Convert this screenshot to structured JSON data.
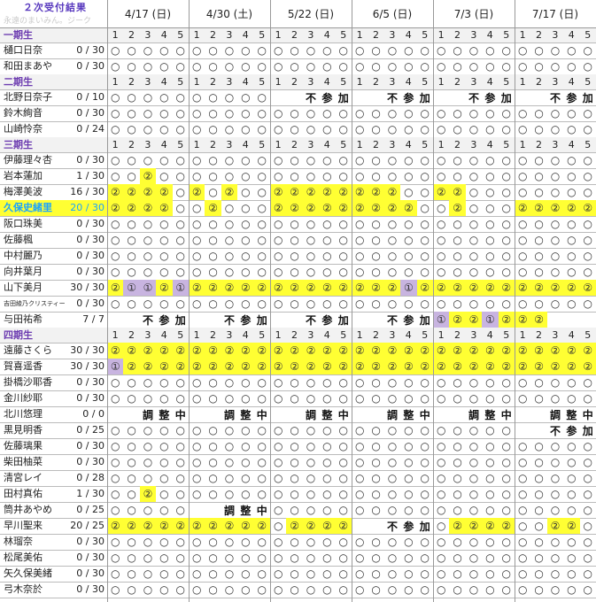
{
  "header": {
    "title": "２次受付結果",
    "watermark": "永遠のまいみん。ジーク"
  },
  "dates": [
    "4/17 (日)",
    "4/30 (土)",
    "5/22 (日)",
    "6/5 (日)",
    "7/3 (日)",
    "7/17 (日)"
  ],
  "slot_numbers": [
    "1",
    "2",
    "3",
    "4",
    "5"
  ],
  "rows": [
    {
      "type": "section",
      "label": "一期生"
    },
    {
      "type": "member",
      "name": "樋口日奈",
      "count": "0 / 30",
      "cells": [
        "o",
        "o",
        "o",
        "o",
        "o",
        "o",
        "o",
        "o",
        "o",
        "o",
        "o",
        "o",
        "o",
        "o",
        "o",
        "o",
        "o",
        "o",
        "o",
        "o",
        "o",
        "o",
        "o",
        "o",
        "o",
        "o",
        "o",
        "o",
        "o",
        "o"
      ]
    },
    {
      "type": "member",
      "name": "和田まあや",
      "count": "0 / 30",
      "cells": [
        "o",
        "o",
        "o",
        "o",
        "o",
        "o",
        "o",
        "o",
        "o",
        "o",
        "o",
        "o",
        "o",
        "o",
        "o",
        "o",
        "o",
        "o",
        "o",
        "o",
        "o",
        "o",
        "o",
        "o",
        "o",
        "o",
        "o",
        "o",
        "o",
        "o"
      ]
    },
    {
      "type": "section",
      "label": "二期生"
    },
    {
      "type": "member",
      "name": "北野日奈子",
      "count": "0 / 10",
      "cells": [
        "o",
        "o",
        "o",
        "o",
        "o",
        "o",
        "o",
        "o",
        "o",
        "o",
        "",
        "",
        "不",
        "参",
        "加",
        "",
        "",
        "不",
        "参",
        "加",
        "",
        "",
        "不",
        "参",
        "加",
        "",
        "",
        "不",
        "参",
        "加"
      ]
    },
    {
      "type": "member",
      "name": "鈴木絢音",
      "count": "0 / 30",
      "cells": [
        "o",
        "o",
        "o",
        "o",
        "o",
        "o",
        "o",
        "o",
        "o",
        "o",
        "o",
        "o",
        "o",
        "o",
        "o",
        "o",
        "o",
        "o",
        "o",
        "o",
        "o",
        "o",
        "o",
        "o",
        "o",
        "o",
        "o",
        "o",
        "o",
        "o"
      ]
    },
    {
      "type": "member",
      "name": "山崎怜奈",
      "count": "0 / 24",
      "cells": [
        "o",
        "o",
        "o",
        "o",
        "o",
        "o",
        "o",
        "o",
        "o",
        "o",
        "o",
        "o",
        "o",
        "o",
        "o",
        "o",
        "o",
        "o",
        "o",
        "o",
        "o",
        "o",
        "o",
        "o",
        "o",
        "o",
        "o",
        "o",
        "o",
        "o"
      ]
    },
    {
      "type": "section",
      "label": "三期生"
    },
    {
      "type": "member",
      "name": "伊藤理々杏",
      "count": "0 / 30",
      "cells": [
        "o",
        "o",
        "o",
        "o",
        "o",
        "o",
        "o",
        "o",
        "o",
        "o",
        "o",
        "o",
        "o",
        "o",
        "o",
        "o",
        "o",
        "o",
        "o",
        "o",
        "o",
        "o",
        "o",
        "o",
        "o",
        "o",
        "o",
        "o",
        "o",
        "o"
      ]
    },
    {
      "type": "member",
      "name": "岩本蓮加",
      "count": "1 / 30",
      "cells": [
        "o",
        "o",
        "Y2",
        "o",
        "o",
        "o",
        "o",
        "o",
        "o",
        "o",
        "o",
        "o",
        "o",
        "o",
        "o",
        "o",
        "o",
        "o",
        "o",
        "o",
        "o",
        "o",
        "o",
        "o",
        "o",
        "o",
        "o",
        "o",
        "o",
        "o"
      ]
    },
    {
      "type": "member",
      "name": "梅澤美波",
      "count": "16 / 30",
      "cells": [
        "Y2",
        "Y2",
        "Y2",
        "Y2",
        "o",
        "Y2",
        "o",
        "Y2",
        "o",
        "o",
        "Y2",
        "Y2",
        "Y2",
        "Y2",
        "Y2",
        "Y2",
        "Y2",
        "Y2",
        "o",
        "o",
        "Y2",
        "Y2",
        "o",
        "o",
        "o",
        "o",
        "o",
        "o",
        "o",
        "o"
      ]
    },
    {
      "type": "member",
      "name": "久保史緒里",
      "count": "20 / 30",
      "hl": true,
      "cells": [
        "Y2",
        "Y2",
        "Y2",
        "Y2",
        "o",
        "o",
        "Y2",
        "o",
        "o",
        "o",
        "Y2",
        "Y2",
        "Y2",
        "Y2",
        "Y2",
        "Y2",
        "Y2",
        "Y2",
        "Y2",
        "o",
        "o",
        "Y2",
        "o",
        "o",
        "o",
        "Y2",
        "Y2",
        "Y2",
        "Y2",
        "Y2"
      ]
    },
    {
      "type": "member",
      "name": "阪口珠美",
      "count": "0 / 30",
      "cells": [
        "o",
        "o",
        "o",
        "o",
        "o",
        "o",
        "o",
        "o",
        "o",
        "o",
        "o",
        "o",
        "o",
        "o",
        "o",
        "o",
        "o",
        "o",
        "o",
        "o",
        "o",
        "o",
        "o",
        "o",
        "o",
        "o",
        "o",
        "o",
        "o",
        "o"
      ]
    },
    {
      "type": "member",
      "name": "佐藤楓",
      "count": "0 / 30",
      "cells": [
        "o",
        "o",
        "o",
        "o",
        "o",
        "o",
        "o",
        "o",
        "o",
        "o",
        "o",
        "o",
        "o",
        "o",
        "o",
        "o",
        "o",
        "o",
        "o",
        "o",
        "o",
        "o",
        "o",
        "o",
        "o",
        "o",
        "o",
        "o",
        "o",
        "o"
      ]
    },
    {
      "type": "member",
      "name": "中村麗乃",
      "count": "0 / 30",
      "cells": [
        "o",
        "o",
        "o",
        "o",
        "o",
        "o",
        "o",
        "o",
        "o",
        "o",
        "o",
        "o",
        "o",
        "o",
        "o",
        "o",
        "o",
        "o",
        "o",
        "o",
        "o",
        "o",
        "o",
        "o",
        "o",
        "o",
        "o",
        "o",
        "o",
        "o"
      ]
    },
    {
      "type": "member",
      "name": "向井葉月",
      "count": "0 / 30",
      "cells": [
        "o",
        "o",
        "o",
        "o",
        "o",
        "o",
        "o",
        "o",
        "o",
        "o",
        "o",
        "o",
        "o",
        "o",
        "o",
        "o",
        "o",
        "o",
        "o",
        "o",
        "o",
        "o",
        "o",
        "o",
        "o",
        "o",
        "o",
        "o",
        "o",
        "o"
      ]
    },
    {
      "type": "member",
      "name": "山下美月",
      "count": "30 / 30",
      "cells": [
        "Y2",
        "P1",
        "P1",
        "Y2",
        "P1",
        "Y2",
        "Y2",
        "Y2",
        "Y2",
        "Y2",
        "Y2",
        "Y2",
        "Y2",
        "Y2",
        "Y2",
        "Y2",
        "Y2",
        "Y2",
        "P1",
        "Y2",
        "Y2",
        "Y2",
        "Y2",
        "Y2",
        "Y2",
        "Y2",
        "Y2",
        "Y2",
        "Y2",
        "Y2"
      ]
    },
    {
      "type": "member",
      "name": "吉田綾乃クリスティー",
      "small": true,
      "count": "0 / 30",
      "cells": [
        "o",
        "o",
        "o",
        "o",
        "o",
        "o",
        "o",
        "o",
        "o",
        "o",
        "o",
        "o",
        "o",
        "o",
        "o",
        "o",
        "o",
        "o",
        "o",
        "o",
        "o",
        "o",
        "o",
        "o",
        "o",
        "o",
        "o",
        "o",
        "o",
        "o"
      ]
    },
    {
      "type": "member",
      "name": "与田祐希",
      "count": "7 / 7",
      "cells": [
        "",
        "",
        "不",
        "参",
        "加",
        "",
        "",
        "不",
        "参",
        "加",
        "",
        "",
        "不",
        "参",
        "加",
        "",
        "",
        "不",
        "参",
        "加",
        "P1",
        "Y2",
        "Y2",
        "P1",
        "Y2",
        "Y2",
        "Y2",
        "",
        "",
        ""
      ]
    },
    {
      "type": "section",
      "label": "四期生"
    },
    {
      "type": "member",
      "name": "遠藤さくら",
      "count": "30 / 30",
      "cells": [
        "Y2",
        "Y2",
        "Y2",
        "Y2",
        "Y2",
        "Y2",
        "Y2",
        "Y2",
        "Y2",
        "Y2",
        "Y2",
        "Y2",
        "Y2",
        "Y2",
        "Y2",
        "Y2",
        "Y2",
        "Y2",
        "Y2",
        "Y2",
        "Y2",
        "Y2",
        "Y2",
        "Y2",
        "Y2",
        "Y2",
        "Y2",
        "Y2",
        "Y2",
        "Y2"
      ]
    },
    {
      "type": "member",
      "name": "賀喜遥香",
      "count": "30 / 30",
      "cells": [
        "P1",
        "Y2",
        "Y2",
        "Y2",
        "Y2",
        "Y2",
        "Y2",
        "Y2",
        "Y2",
        "Y2",
        "Y2",
        "Y2",
        "Y2",
        "Y2",
        "Y2",
        "Y2",
        "Y2",
        "Y2",
        "Y2",
        "Y2",
        "Y2",
        "Y2",
        "Y2",
        "Y2",
        "Y2",
        "Y2",
        "Y2",
        "Y2",
        "Y2",
        "Y2"
      ]
    },
    {
      "type": "member",
      "name": "掛橋沙耶香",
      "count": "0 / 30",
      "cells": [
        "o",
        "o",
        "o",
        "o",
        "o",
        "o",
        "o",
        "o",
        "o",
        "o",
        "o",
        "o",
        "o",
        "o",
        "o",
        "o",
        "o",
        "o",
        "o",
        "o",
        "o",
        "o",
        "o",
        "o",
        "o",
        "o",
        "o",
        "o",
        "o",
        "o"
      ]
    },
    {
      "type": "member",
      "name": "金川紗耶",
      "count": "0 / 30",
      "cells": [
        "o",
        "o",
        "o",
        "o",
        "o",
        "o",
        "o",
        "o",
        "o",
        "o",
        "o",
        "o",
        "o",
        "o",
        "o",
        "o",
        "o",
        "o",
        "o",
        "o",
        "o",
        "o",
        "o",
        "o",
        "o",
        "o",
        "o",
        "o",
        "o",
        "o"
      ]
    },
    {
      "type": "member",
      "name": "北川悠理",
      "count": "0 / 0",
      "cells": [
        "",
        "",
        "調",
        "整",
        "中",
        "",
        "",
        "調",
        "整",
        "中",
        "",
        "",
        "調",
        "整",
        "中",
        "",
        "",
        "調",
        "整",
        "中",
        "",
        "",
        "調",
        "整",
        "中",
        "",
        "",
        "調",
        "整",
        "中"
      ]
    },
    {
      "type": "member",
      "name": "黒見明香",
      "count": "0 / 25",
      "cells": [
        "o",
        "o",
        "o",
        "o",
        "o",
        "o",
        "o",
        "o",
        "o",
        "o",
        "o",
        "o",
        "o",
        "o",
        "o",
        "o",
        "o",
        "o",
        "o",
        "o",
        "o",
        "o",
        "o",
        "o",
        "o",
        "",
        "",
        "不",
        "参",
        "加"
      ]
    },
    {
      "type": "member",
      "name": "佐藤璃果",
      "count": "0 / 30",
      "cells": [
        "o",
        "o",
        "o",
        "o",
        "o",
        "o",
        "o",
        "o",
        "o",
        "o",
        "o",
        "o",
        "o",
        "o",
        "o",
        "o",
        "o",
        "o",
        "o",
        "o",
        "o",
        "o",
        "o",
        "o",
        "o",
        "o",
        "o",
        "o",
        "o",
        "o"
      ]
    },
    {
      "type": "member",
      "name": "柴田柚菜",
      "count": "0 / 30",
      "cells": [
        "o",
        "o",
        "o",
        "o",
        "o",
        "o",
        "o",
        "o",
        "o",
        "o",
        "o",
        "o",
        "o",
        "o",
        "o",
        "o",
        "o",
        "o",
        "o",
        "o",
        "o",
        "o",
        "o",
        "o",
        "o",
        "o",
        "o",
        "o",
        "o",
        "o"
      ]
    },
    {
      "type": "member",
      "name": "清宮レイ",
      "count": "0 / 28",
      "cells": [
        "o",
        "o",
        "o",
        "o",
        "o",
        "o",
        "o",
        "o",
        "o",
        "o",
        "o",
        "o",
        "o",
        "o",
        "o",
        "o",
        "o",
        "o",
        "o",
        "o",
        "o",
        "o",
        "o",
        "o",
        "o",
        "o",
        "o",
        "o",
        "o",
        "o"
      ]
    },
    {
      "type": "member",
      "name": "田村真佑",
      "count": "1 / 30",
      "cells": [
        "o",
        "o",
        "Y2",
        "o",
        "o",
        "o",
        "o",
        "o",
        "o",
        "o",
        "o",
        "o",
        "o",
        "o",
        "o",
        "o",
        "o",
        "o",
        "o",
        "o",
        "o",
        "o",
        "o",
        "o",
        "o",
        "o",
        "o",
        "o",
        "o",
        "o"
      ]
    },
    {
      "type": "member",
      "name": "筒井あやめ",
      "count": "0 / 25",
      "cells": [
        "o",
        "o",
        "o",
        "o",
        "o",
        "",
        "",
        "調",
        "整",
        "中",
        "o",
        "o",
        "o",
        "o",
        "o",
        "o",
        "o",
        "o",
        "o",
        "o",
        "o",
        "o",
        "o",
        "o",
        "o",
        "o",
        "o",
        "o",
        "o",
        "o"
      ]
    },
    {
      "type": "member",
      "name": "早川聖来",
      "count": "20 / 25",
      "cells": [
        "Y2",
        "Y2",
        "Y2",
        "Y2",
        "Y2",
        "Y2",
        "Y2",
        "Y2",
        "Y2",
        "Y2",
        "o",
        "Y2",
        "Y2",
        "Y2",
        "Y2",
        "",
        "",
        "不",
        "参",
        "加",
        "o",
        "Y2",
        "Y2",
        "Y2",
        "Y2",
        "o",
        "o",
        "Y2",
        "Y2",
        "o"
      ]
    },
    {
      "type": "member",
      "name": "林瑠奈",
      "count": "0 / 30",
      "cells": [
        "o",
        "o",
        "o",
        "o",
        "o",
        "o",
        "o",
        "o",
        "o",
        "o",
        "o",
        "o",
        "o",
        "o",
        "o",
        "o",
        "o",
        "o",
        "o",
        "o",
        "o",
        "o",
        "o",
        "o",
        "o",
        "o",
        "o",
        "o",
        "o",
        "o"
      ]
    },
    {
      "type": "member",
      "name": "松尾美佑",
      "count": "0 / 30",
      "cells": [
        "o",
        "o",
        "o",
        "o",
        "o",
        "o",
        "o",
        "o",
        "o",
        "o",
        "o",
        "o",
        "o",
        "o",
        "o",
        "o",
        "o",
        "o",
        "o",
        "o",
        "o",
        "o",
        "o",
        "o",
        "o",
        "o",
        "o",
        "o",
        "o",
        "o"
      ]
    },
    {
      "type": "member",
      "name": "矢久保美緒",
      "count": "0 / 30",
      "cells": [
        "o",
        "o",
        "o",
        "o",
        "o",
        "o",
        "o",
        "o",
        "o",
        "o",
        "o",
        "o",
        "o",
        "o",
        "o",
        "o",
        "o",
        "o",
        "o",
        "o",
        "o",
        "o",
        "o",
        "o",
        "o",
        "o",
        "o",
        "o",
        "o",
        "o"
      ]
    },
    {
      "type": "member",
      "name": "弓木奈於",
      "count": "0 / 30",
      "cells": [
        "o",
        "o",
        "o",
        "o",
        "o",
        "o",
        "o",
        "o",
        "o",
        "o",
        "o",
        "o",
        "o",
        "o",
        "o",
        "o",
        "o",
        "o",
        "o",
        "o",
        "o",
        "o",
        "o",
        "o",
        "o",
        "o",
        "o",
        "o",
        "o",
        "o"
      ]
    }
  ],
  "symbols": {
    "o": "○",
    "Y2": "②",
    "P1": "①"
  },
  "colors": {
    "yellow": "#ffff33",
    "purple": "#c8b4e0",
    "section_text": "#6c3bb0",
    "highlight_text": "#1aa3ff"
  }
}
